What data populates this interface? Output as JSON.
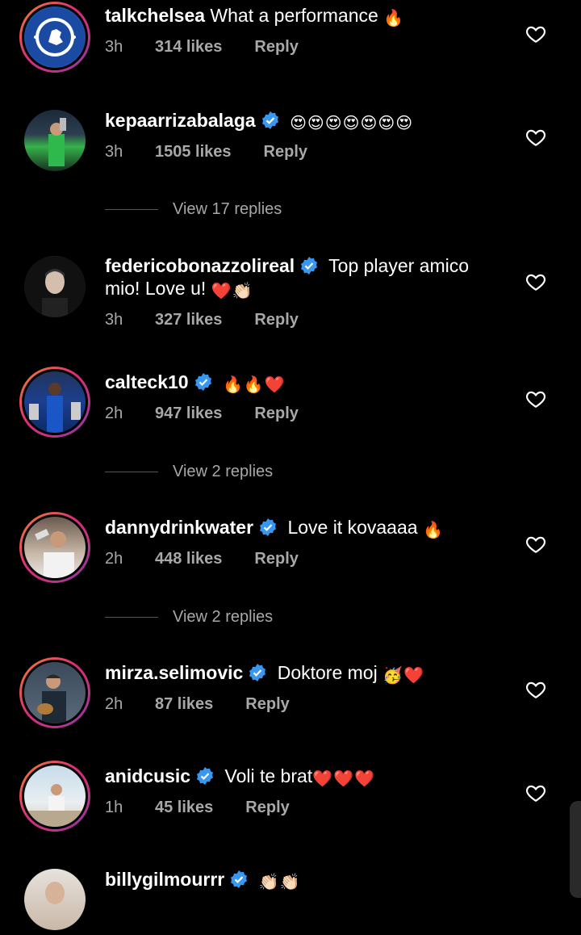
{
  "comments": [
    {
      "username": "talkchelsea",
      "verified": false,
      "text": "What a performance",
      "emoji": [
        "🔥"
      ],
      "time": "3h",
      "likes": "314 likes",
      "reply": "Reply",
      "avatar": "chelsea-crest-icon"
    },
    {
      "username": "kepaarrizabalaga",
      "verified": true,
      "text": "",
      "emoji": [
        "😍",
        "😍",
        "😍",
        "😍",
        "😍",
        "😍",
        "😍"
      ],
      "time": "3h",
      "likes": "1505 likes",
      "reply": "Reply",
      "avatar": "user-photo"
    },
    {
      "username": "federicobonazzolireal",
      "verified": true,
      "text": "Top player amico",
      "text2": "mio! Love u!",
      "emoji": [
        "❤️",
        "👏🏻"
      ],
      "time": "3h",
      "likes": "327 likes",
      "reply": "Reply",
      "avatar": "user-photo"
    },
    {
      "username": "calteck10",
      "verified": true,
      "text": "",
      "emoji": [
        "🔥",
        "🔥",
        "❤️"
      ],
      "time": "2h",
      "likes": "947 likes",
      "reply": "Reply",
      "avatar": "user-photo"
    },
    {
      "username": "dannydrinkwater",
      "verified": true,
      "text": "Love it kovaaaa",
      "emoji": [
        "🔥"
      ],
      "time": "2h",
      "likes": "448 likes",
      "reply": "Reply",
      "avatar": "user-photo"
    },
    {
      "username": "mirza.selimovic",
      "verified": true,
      "text": "Doktore moj",
      "emoji": [
        "🥳",
        "❤️"
      ],
      "time": "2h",
      "likes": "87 likes",
      "reply": "Reply",
      "avatar": "user-photo"
    },
    {
      "username": "anidcusic",
      "verified": true,
      "text": "Voli te brat",
      "emoji": [
        "❤️",
        "❤️",
        "❤️"
      ],
      "time": "1h",
      "likes": "45 likes",
      "reply": "Reply",
      "avatar": "user-photo"
    },
    {
      "username": "billygilmourrr",
      "verified": true,
      "text": "",
      "emoji": [
        "👏🏻",
        "👏🏻"
      ],
      "time": "",
      "likes": "",
      "reply": "",
      "avatar": "user-photo"
    }
  ],
  "view_replies": [
    {
      "label": "View 17 replies"
    },
    {
      "label": "View 2 replies"
    },
    {
      "label": "View 2 replies"
    }
  ],
  "colors": {
    "background": "#000000",
    "meta": "#a8a8a8",
    "verified": "#3897f0",
    "ring": "#dd2a7b"
  }
}
